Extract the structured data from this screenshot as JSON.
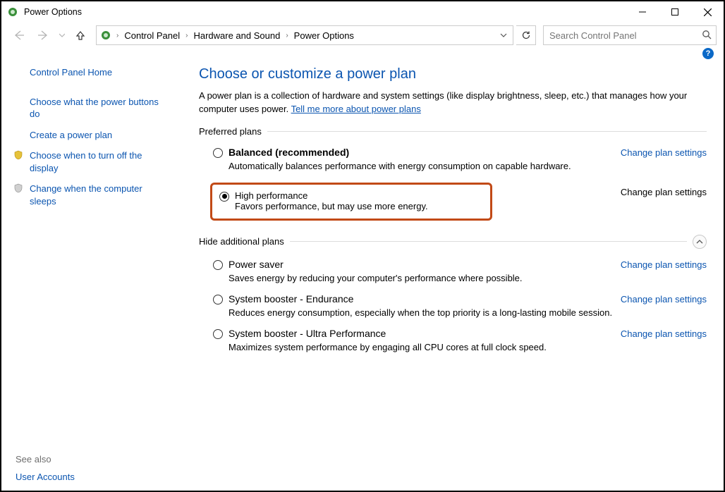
{
  "window": {
    "title": "Power Options"
  },
  "breadcrumb": {
    "items": [
      "Control Panel",
      "Hardware and Sound",
      "Power Options"
    ]
  },
  "search": {
    "placeholder": "Search Control Panel"
  },
  "sidebar": {
    "home": "Control Panel Home",
    "links": [
      "Choose what the power buttons do",
      "Create a power plan",
      "Choose when to turn off the display",
      "Change when the computer sleeps"
    ],
    "see_also_label": "See also",
    "user_accounts": "User Accounts"
  },
  "main": {
    "heading": "Choose or customize a power plan",
    "intro_a": "A power plan is a collection of hardware and system settings (like display brightness, sleep, etc.) that manages how your computer uses power. ",
    "intro_link": "Tell me more about power plans",
    "preferred_label": "Preferred plans",
    "hide_label": "Hide additional plans",
    "change_link": "Change plan settings",
    "plans": {
      "balanced": {
        "title": "Balanced (recommended)",
        "desc": "Automatically balances performance with energy consumption on capable hardware."
      },
      "high_perf": {
        "title": "High performance",
        "desc": "Favors performance, but may use more energy."
      },
      "power_saver": {
        "title": "Power saver",
        "desc": "Saves energy by reducing your computer's performance where possible."
      },
      "endurance": {
        "title": "System booster - Endurance",
        "desc": "Reduces energy consumption, especially when the top priority is a long-lasting mobile session."
      },
      "ultra": {
        "title": "System booster - Ultra Performance",
        "desc": "Maximizes system performance by engaging all CPU cores at full clock speed."
      }
    }
  }
}
